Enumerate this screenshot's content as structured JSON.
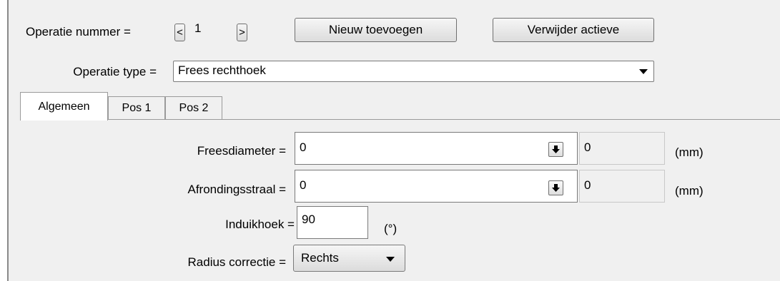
{
  "header": {
    "operation_number_label": "Operatie nummer =",
    "operation_number_value": "1",
    "prev_label": "<",
    "next_label": ">",
    "add_button": "Nieuw toevoegen",
    "delete_button": "Verwijder actieve",
    "operation_type_label": "Operatie type =",
    "operation_type_value": "Frees rechthoek"
  },
  "tabs": [
    {
      "label": "Algemeen",
      "active": true
    },
    {
      "label": "Pos 1",
      "active": false
    },
    {
      "label": "Pos 2",
      "active": false
    }
  ],
  "general": {
    "mill_diameter": {
      "label": "Freesdiameter =",
      "value": "0",
      "readonly_value": "0",
      "unit": "(mm)"
    },
    "rounding_radius": {
      "label": "Afrondingsstraal =",
      "value": "0",
      "readonly_value": "0",
      "unit": "(mm)"
    },
    "plunge_angle": {
      "label": "Induikhoek =",
      "value": "90",
      "unit": "(°)"
    },
    "radius_correction": {
      "label": "Radius correctie =",
      "value": "Rechts"
    }
  },
  "colors": {
    "panel": "#f0f0f0",
    "border": "#7a7a7a",
    "divider": "#8a8a8a"
  }
}
